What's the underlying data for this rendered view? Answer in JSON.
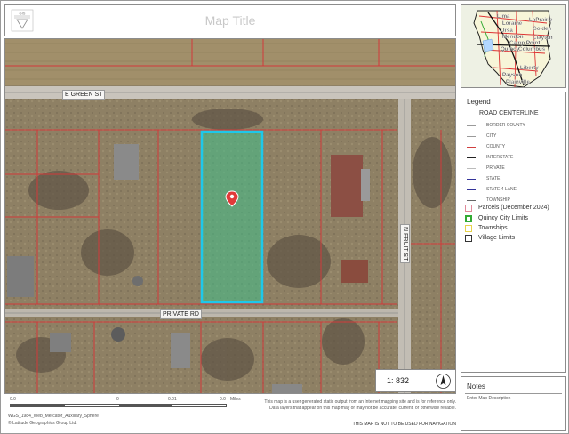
{
  "title": {
    "text": "Map Title",
    "logo_text": "GIS"
  },
  "map": {
    "roads": {
      "green": "E GREEN ST",
      "private": "PRIVATE RD",
      "fruit": "N FRUIT ST"
    },
    "scale_ratio": "1: 832",
    "icons": {
      "pin": "location-pin-icon",
      "north": "north-arrow-icon"
    },
    "colors": {
      "selected_parcel": "#1ec8ea",
      "parcel_lines": "#d23a3a",
      "road_centerline": "#8e8e8e"
    }
  },
  "overview": {
    "places": [
      "Lima",
      "LaPrairie",
      "Loraine",
      "Ursa",
      "Golden",
      "Mendon",
      "Clayton",
      "Camp Point",
      "Quincy",
      "Columbus",
      "Liberty",
      "Payson",
      "Plainville"
    ]
  },
  "legend": {
    "title": "Legend",
    "road_heading": "ROAD CENTERLINE",
    "road_items": [
      {
        "label": "BORDER COUNTY",
        "color": "#9a9a9a"
      },
      {
        "label": "CITY",
        "color": "#9a9a9a"
      },
      {
        "label": "COUNTY",
        "color": "#d04040"
      },
      {
        "label": "INTERSTATE",
        "color": "#222222"
      },
      {
        "label": "PRIVATE",
        "color": "#bbbbbb"
      },
      {
        "label": "STATE",
        "color": "#333399"
      },
      {
        "label": "STATE 4 LANE",
        "color": "#333399"
      },
      {
        "label": "TOWNSHIP",
        "color": "#666666"
      }
    ],
    "layers": [
      {
        "label": "Parcels (December 2024)",
        "color": "#e08a9a"
      },
      {
        "label": "Quincy City Limits",
        "color": "#33aa33"
      },
      {
        "label": "Townships",
        "color": "#e6d24a"
      },
      {
        "label": "Village Limits",
        "color": "#333333"
      }
    ]
  },
  "notes": {
    "title": "Notes",
    "text": "Enter Map Description"
  },
  "footer": {
    "scale_ticks": [
      "0.0",
      "0",
      "0.01",
      "0.0"
    ],
    "scale_unit": "Miles",
    "projection": "WGS_1984_Web_Mercator_Auxiliary_Sphere",
    "copyright": "© Latitude Geographics Group Ltd.",
    "disclaimer": "This map is a user generated static output from an Internet mapping site and is for reference only. Data layers that appear on this map may or may not be accurate, current, or otherwise reliable.",
    "warning": "THIS MAP IS NOT TO BE USED FOR NAVIGATION"
  }
}
